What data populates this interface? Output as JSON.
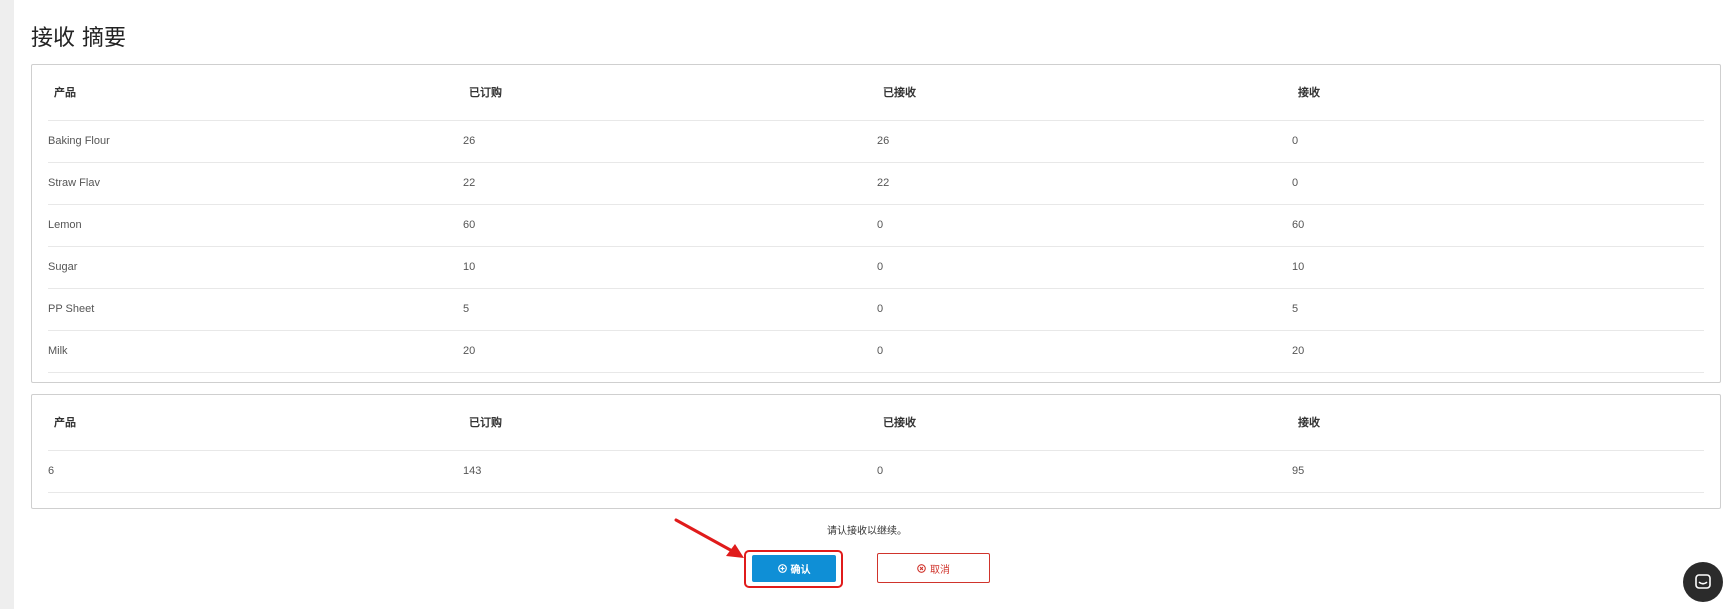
{
  "page": {
    "title": "接收 摘要"
  },
  "items_table": {
    "headers": [
      "产品",
      "已订购",
      "已接收",
      "接收"
    ],
    "rows": [
      [
        "Baking Flour",
        "26",
        "26",
        "0"
      ],
      [
        "Straw Flav",
        "22",
        "22",
        "0"
      ],
      [
        "Lemon",
        "60",
        "0",
        "60"
      ],
      [
        "Sugar",
        "10",
        "0",
        "10"
      ],
      [
        "PP Sheet",
        "5",
        "0",
        "5"
      ],
      [
        "Milk",
        "20",
        "0",
        "20"
      ]
    ]
  },
  "totals_table": {
    "headers": [
      "产品",
      "已订购",
      "已接收",
      "接收"
    ],
    "rows": [
      [
        "6",
        "143",
        "0",
        "95"
      ]
    ]
  },
  "actions": {
    "message": "请认接收以继续。",
    "confirm_label": "确认",
    "cancel_label": "取消",
    "confirm_icon": "plus-circle-icon",
    "cancel_icon": "x-circle-icon"
  },
  "colors": {
    "primary": "#0f8fd6",
    "danger": "#d0342c",
    "annotation": "#e01b1b"
  }
}
